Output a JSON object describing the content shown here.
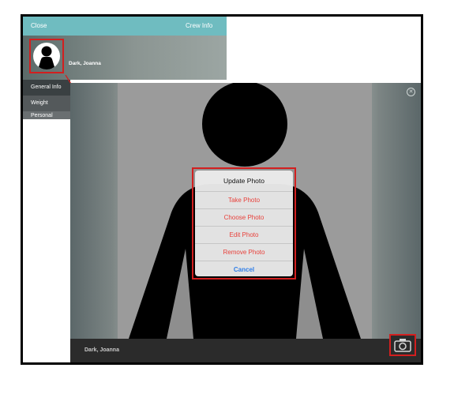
{
  "panel": {
    "close_label": "Close",
    "title": "Crew Info",
    "profile_name": "Dark, Joanna",
    "menu": [
      "General Info",
      "Weight",
      "Personal"
    ]
  },
  "viewer": {
    "footer_name": "Dark, Joanna",
    "close_icon": "close-circle-icon",
    "camera_icon": "camera-icon"
  },
  "action_sheet": {
    "title": "Update Photo",
    "options": [
      "Take Photo",
      "Choose Photo",
      "Edit Photo",
      "Remove Photo"
    ],
    "cancel": "Cancel"
  },
  "colors": {
    "header_teal": "#6fbcc0",
    "highlight_red": "#d21f1f",
    "destructive_red": "#e8413b",
    "cancel_blue": "#2f7ee8"
  }
}
